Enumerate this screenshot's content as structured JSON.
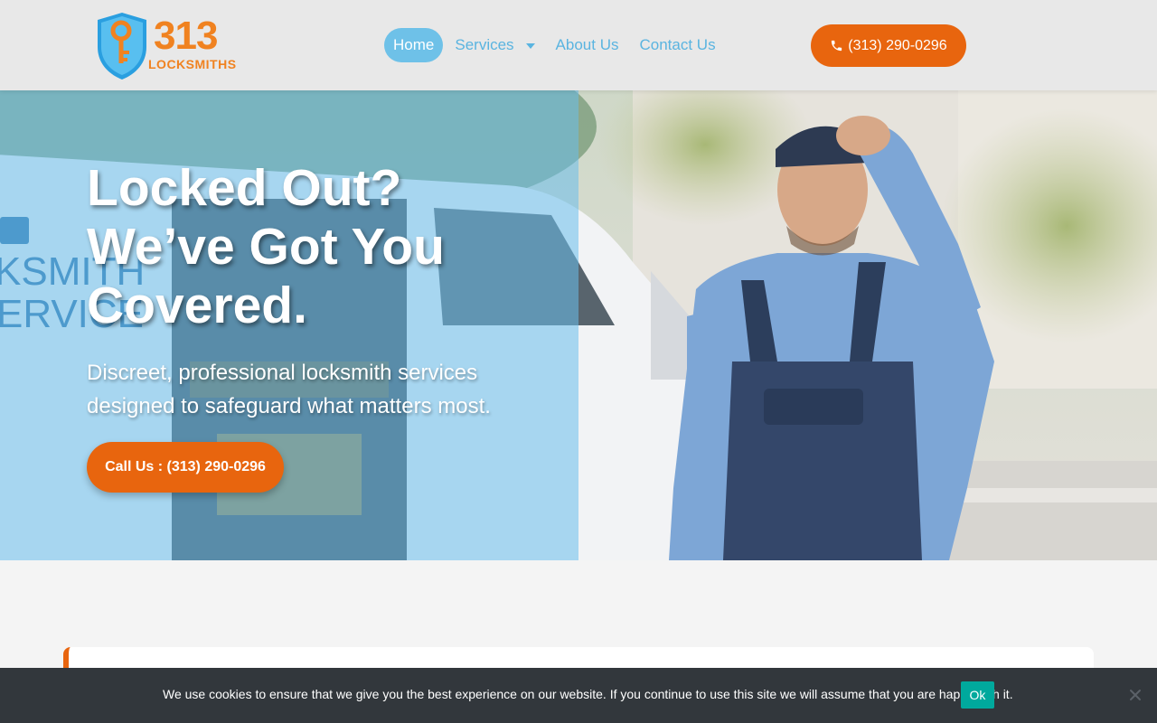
{
  "header": {
    "logo_number": "313",
    "logo_word": "LOCKSMITHS",
    "nav": [
      {
        "label": "Home",
        "active": true
      },
      {
        "label": "Services",
        "has_dropdown": true
      },
      {
        "label": "About Us"
      },
      {
        "label": "Contact Us"
      }
    ],
    "phone_button_label": "(313) 290-0296",
    "phone_icon": "phone-icon"
  },
  "hero": {
    "title": "Locked Out? We’ve Got You Covered.",
    "subtitle": "Discreet, professional locksmith services designed to safeguard what matters most.",
    "cta_label": "Call Us : (313) 290-0296"
  },
  "cookie_bar": {
    "message": "We use cookies to ensure that we give you the best experience on our website. If you continue to use this site we will assume that you are happy with it.",
    "ok_label": "Ok",
    "close_icon": "close-icon"
  },
  "colors": {
    "accent_orange": "#e8650e",
    "accent_blue": "#5ab4e0",
    "cookie_bg": "#32373c",
    "ok_green": "#00a99d"
  }
}
